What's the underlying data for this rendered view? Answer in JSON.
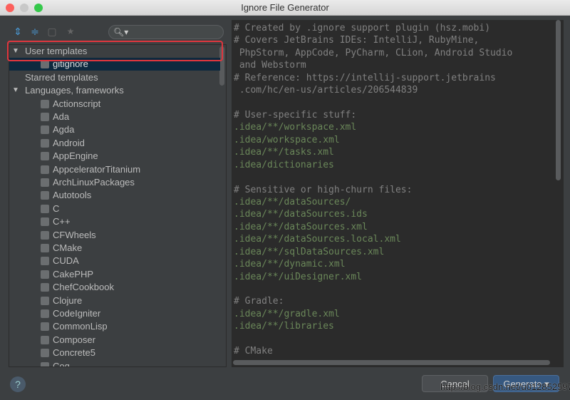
{
  "window": {
    "title": "Ignore File Generator"
  },
  "search": {
    "icon": "search-icon"
  },
  "tree": [
    {
      "label": "User templates",
      "type": "group",
      "expanded": true
    },
    {
      "label": "gitignore",
      "type": "item",
      "selected": true
    },
    {
      "label": "Starred templates",
      "type": "group",
      "expanded": false
    },
    {
      "label": "Languages, frameworks",
      "type": "group",
      "expanded": true
    },
    {
      "label": "Actionscript",
      "type": "item"
    },
    {
      "label": "Ada",
      "type": "item"
    },
    {
      "label": "Agda",
      "type": "item"
    },
    {
      "label": "Android",
      "type": "item"
    },
    {
      "label": "AppEngine",
      "type": "item"
    },
    {
      "label": "AppceleratorTitanium",
      "type": "item"
    },
    {
      "label": "ArchLinuxPackages",
      "type": "item"
    },
    {
      "label": "Autotools",
      "type": "item"
    },
    {
      "label": "C",
      "type": "item"
    },
    {
      "label": "C++",
      "type": "item"
    },
    {
      "label": "CFWheels",
      "type": "item"
    },
    {
      "label": "CMake",
      "type": "item"
    },
    {
      "label": "CUDA",
      "type": "item"
    },
    {
      "label": "CakePHP",
      "type": "item"
    },
    {
      "label": "ChefCookbook",
      "type": "item"
    },
    {
      "label": "Clojure",
      "type": "item"
    },
    {
      "label": "CodeIgniter",
      "type": "item"
    },
    {
      "label": "CommonLisp",
      "type": "item"
    },
    {
      "label": "Composer",
      "type": "item"
    },
    {
      "label": "Concrete5",
      "type": "item"
    },
    {
      "label": "Coq",
      "type": "item"
    }
  ],
  "editor": {
    "lines": [
      {
        "t": "# Created by .ignore support plugin (hsz.mobi)",
        "k": "c"
      },
      {
        "t": "# Covers JetBrains IDEs: IntelliJ, RubyMine,",
        "k": "c"
      },
      {
        "t": " PhpStorm, AppCode, PyCharm, CLion, Android Studio",
        "k": "c"
      },
      {
        "t": " and Webstorm",
        "k": "c"
      },
      {
        "t": "# Reference: https://intellij-support.jetbrains",
        "k": "c"
      },
      {
        "t": " .com/hc/en-us/articles/206544839",
        "k": "c"
      },
      {
        "t": "",
        "k": "c"
      },
      {
        "t": "# User-specific stuff:",
        "k": "c"
      },
      {
        "t": ".idea/**/workspace.xml",
        "k": "g"
      },
      {
        "t": ".idea/workspace.xml",
        "k": "g"
      },
      {
        "t": ".idea/**/tasks.xml",
        "k": "g"
      },
      {
        "t": ".idea/dictionaries",
        "k": "g"
      },
      {
        "t": "",
        "k": "c"
      },
      {
        "t": "# Sensitive or high-churn files:",
        "k": "c"
      },
      {
        "t": ".idea/**/dataSources/",
        "k": "g"
      },
      {
        "t": ".idea/**/dataSources.ids",
        "k": "g"
      },
      {
        "t": ".idea/**/dataSources.xml",
        "k": "g"
      },
      {
        "t": ".idea/**/dataSources.local.xml",
        "k": "g"
      },
      {
        "t": ".idea/**/sqlDataSources.xml",
        "k": "g"
      },
      {
        "t": ".idea/**/dynamic.xml",
        "k": "g"
      },
      {
        "t": ".idea/**/uiDesigner.xml",
        "k": "g"
      },
      {
        "t": "",
        "k": "c"
      },
      {
        "t": "# Gradle:",
        "k": "c"
      },
      {
        "t": ".idea/**/gradle.xml",
        "k": "g"
      },
      {
        "t": ".idea/**/libraries",
        "k": "g"
      },
      {
        "t": "",
        "k": "c"
      },
      {
        "t": "# CMake",
        "k": "c"
      }
    ]
  },
  "footer": {
    "help": "?",
    "cancel": "Cancel",
    "generate": "Generate ▾"
  },
  "watermark": "http://blog.csdn.net/u012852597",
  "colors": {
    "highlight": "#e0363e",
    "comment": "#808080",
    "path": "#6a8759",
    "selection": "#0d293e"
  }
}
